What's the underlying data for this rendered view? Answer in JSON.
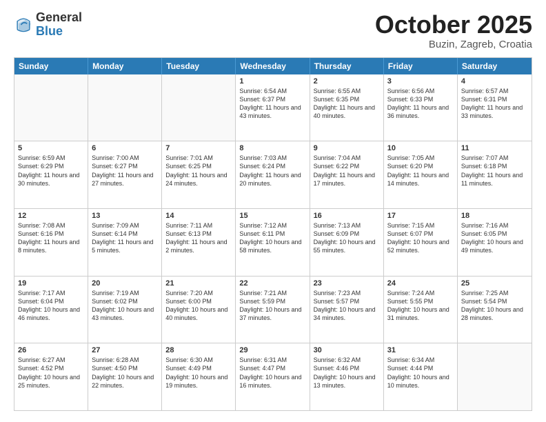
{
  "header": {
    "logo_general": "General",
    "logo_blue": "Blue",
    "month_title": "October 2025",
    "location": "Buzin, Zagreb, Croatia"
  },
  "weekdays": [
    "Sunday",
    "Monday",
    "Tuesday",
    "Wednesday",
    "Thursday",
    "Friday",
    "Saturday"
  ],
  "rows": [
    [
      {
        "day": "",
        "text": ""
      },
      {
        "day": "",
        "text": ""
      },
      {
        "day": "",
        "text": ""
      },
      {
        "day": "1",
        "text": "Sunrise: 6:54 AM\nSunset: 6:37 PM\nDaylight: 11 hours and 43 minutes."
      },
      {
        "day": "2",
        "text": "Sunrise: 6:55 AM\nSunset: 6:35 PM\nDaylight: 11 hours and 40 minutes."
      },
      {
        "day": "3",
        "text": "Sunrise: 6:56 AM\nSunset: 6:33 PM\nDaylight: 11 hours and 36 minutes."
      },
      {
        "day": "4",
        "text": "Sunrise: 6:57 AM\nSunset: 6:31 PM\nDaylight: 11 hours and 33 minutes."
      }
    ],
    [
      {
        "day": "5",
        "text": "Sunrise: 6:59 AM\nSunset: 6:29 PM\nDaylight: 11 hours and 30 minutes."
      },
      {
        "day": "6",
        "text": "Sunrise: 7:00 AM\nSunset: 6:27 PM\nDaylight: 11 hours and 27 minutes."
      },
      {
        "day": "7",
        "text": "Sunrise: 7:01 AM\nSunset: 6:25 PM\nDaylight: 11 hours and 24 minutes."
      },
      {
        "day": "8",
        "text": "Sunrise: 7:03 AM\nSunset: 6:24 PM\nDaylight: 11 hours and 20 minutes."
      },
      {
        "day": "9",
        "text": "Sunrise: 7:04 AM\nSunset: 6:22 PM\nDaylight: 11 hours and 17 minutes."
      },
      {
        "day": "10",
        "text": "Sunrise: 7:05 AM\nSunset: 6:20 PM\nDaylight: 11 hours and 14 minutes."
      },
      {
        "day": "11",
        "text": "Sunrise: 7:07 AM\nSunset: 6:18 PM\nDaylight: 11 hours and 11 minutes."
      }
    ],
    [
      {
        "day": "12",
        "text": "Sunrise: 7:08 AM\nSunset: 6:16 PM\nDaylight: 11 hours and 8 minutes."
      },
      {
        "day": "13",
        "text": "Sunrise: 7:09 AM\nSunset: 6:14 PM\nDaylight: 11 hours and 5 minutes."
      },
      {
        "day": "14",
        "text": "Sunrise: 7:11 AM\nSunset: 6:13 PM\nDaylight: 11 hours and 2 minutes."
      },
      {
        "day": "15",
        "text": "Sunrise: 7:12 AM\nSunset: 6:11 PM\nDaylight: 10 hours and 58 minutes."
      },
      {
        "day": "16",
        "text": "Sunrise: 7:13 AM\nSunset: 6:09 PM\nDaylight: 10 hours and 55 minutes."
      },
      {
        "day": "17",
        "text": "Sunrise: 7:15 AM\nSunset: 6:07 PM\nDaylight: 10 hours and 52 minutes."
      },
      {
        "day": "18",
        "text": "Sunrise: 7:16 AM\nSunset: 6:05 PM\nDaylight: 10 hours and 49 minutes."
      }
    ],
    [
      {
        "day": "19",
        "text": "Sunrise: 7:17 AM\nSunset: 6:04 PM\nDaylight: 10 hours and 46 minutes."
      },
      {
        "day": "20",
        "text": "Sunrise: 7:19 AM\nSunset: 6:02 PM\nDaylight: 10 hours and 43 minutes."
      },
      {
        "day": "21",
        "text": "Sunrise: 7:20 AM\nSunset: 6:00 PM\nDaylight: 10 hours and 40 minutes."
      },
      {
        "day": "22",
        "text": "Sunrise: 7:21 AM\nSunset: 5:59 PM\nDaylight: 10 hours and 37 minutes."
      },
      {
        "day": "23",
        "text": "Sunrise: 7:23 AM\nSunset: 5:57 PM\nDaylight: 10 hours and 34 minutes."
      },
      {
        "day": "24",
        "text": "Sunrise: 7:24 AM\nSunset: 5:55 PM\nDaylight: 10 hours and 31 minutes."
      },
      {
        "day": "25",
        "text": "Sunrise: 7:25 AM\nSunset: 5:54 PM\nDaylight: 10 hours and 28 minutes."
      }
    ],
    [
      {
        "day": "26",
        "text": "Sunrise: 6:27 AM\nSunset: 4:52 PM\nDaylight: 10 hours and 25 minutes."
      },
      {
        "day": "27",
        "text": "Sunrise: 6:28 AM\nSunset: 4:50 PM\nDaylight: 10 hours and 22 minutes."
      },
      {
        "day": "28",
        "text": "Sunrise: 6:30 AM\nSunset: 4:49 PM\nDaylight: 10 hours and 19 minutes."
      },
      {
        "day": "29",
        "text": "Sunrise: 6:31 AM\nSunset: 4:47 PM\nDaylight: 10 hours and 16 minutes."
      },
      {
        "day": "30",
        "text": "Sunrise: 6:32 AM\nSunset: 4:46 PM\nDaylight: 10 hours and 13 minutes."
      },
      {
        "day": "31",
        "text": "Sunrise: 6:34 AM\nSunset: 4:44 PM\nDaylight: 10 hours and 10 minutes."
      },
      {
        "day": "",
        "text": ""
      }
    ]
  ]
}
